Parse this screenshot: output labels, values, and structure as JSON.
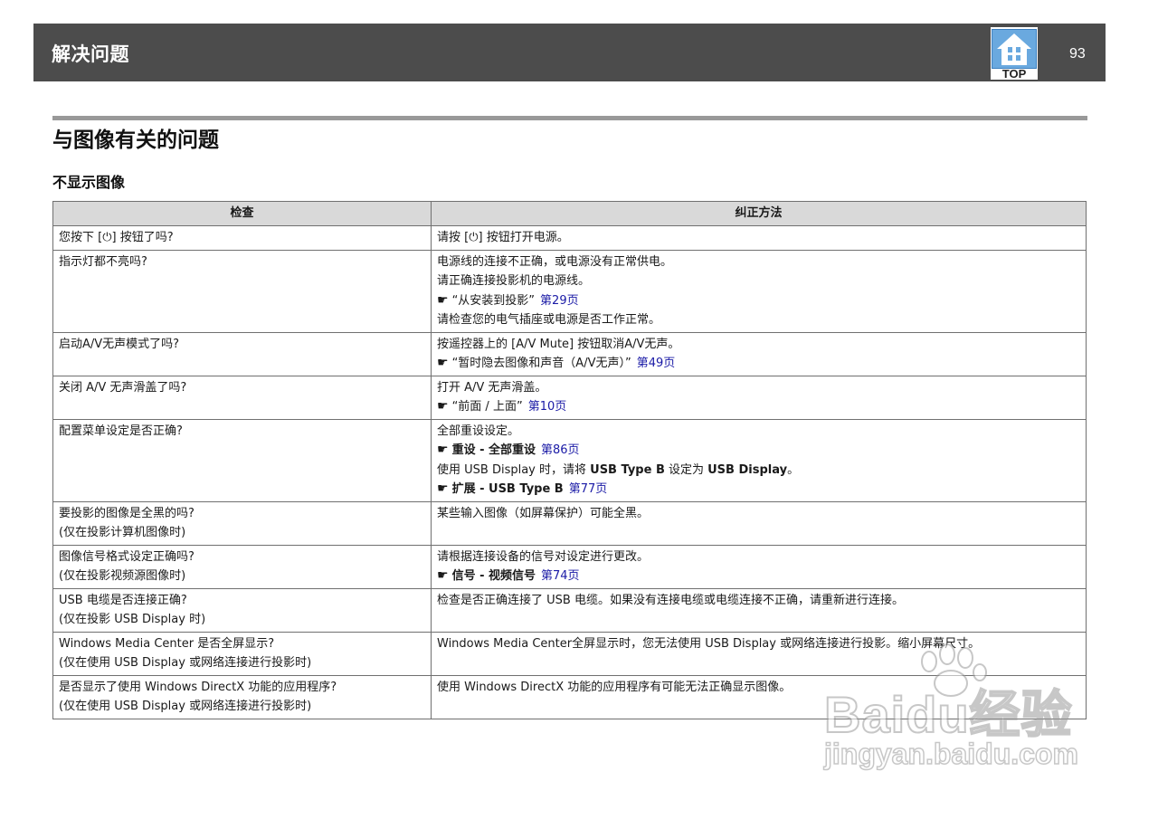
{
  "header": {
    "title": "解决问题",
    "top_label": "TOP",
    "page_number": "93"
  },
  "section_title": "与图像有关的问题",
  "subsection_title": "不显示图像",
  "table": {
    "columns": [
      "检查",
      "纠正方法"
    ],
    "rows": [
      {
        "check": [
          "您按下 [⏻] 按钮了吗?"
        ],
        "fix": [
          {
            "text": "请按 [⏻] 按钮打开电源。"
          }
        ]
      },
      {
        "check": [
          "指示灯都不亮吗?"
        ],
        "fix": [
          {
            "text": "电源线的连接不正确，或电源没有正常供电。"
          },
          {
            "text": "请正确连接投影机的电源线。"
          },
          {
            "ref": "“从安装到投影”",
            "page": "第29页"
          },
          {
            "text": "请检查您的电气插座或电源是否工作正常。"
          }
        ]
      },
      {
        "check": [
          "启动A/V无声模式了吗?"
        ],
        "fix": [
          {
            "text": "按遥控器上的 [A/V Mute] 按钮取消A/V无声。"
          },
          {
            "ref": "“暂时隐去图像和声音（A/V无声）”",
            "page": "第49页"
          }
        ]
      },
      {
        "check": [
          "关闭 A/V 无声滑盖了吗?"
        ],
        "fix": [
          {
            "text": "打开 A/V 无声滑盖。"
          },
          {
            "ref": "“前面 / 上面”",
            "page": "第10页"
          }
        ]
      },
      {
        "check": [
          "配置菜单设定是否正确?"
        ],
        "fix": [
          {
            "text": "全部重设设定。"
          },
          {
            "menu": "重设 - 全部重设",
            "page": "第86页"
          },
          {
            "text_a": "使用 USB Display 时，请将 ",
            "bold_a": "USB Type B",
            "text_b": " 设定为 ",
            "bold_b": "USB Display",
            "text_c": "。"
          },
          {
            "menu": "扩展 - USB Type B",
            "page": "第77页"
          }
        ]
      },
      {
        "check": [
          "要投影的图像是全黑的吗?",
          "(仅在投影计算机图像时)"
        ],
        "fix": [
          {
            "text": "某些输入图像（如屏幕保护）可能全黑。"
          }
        ]
      },
      {
        "check": [
          "图像信号格式设定正确吗?",
          "(仅在投影视频源图像时)"
        ],
        "fix": [
          {
            "text": "请根据连接设备的信号对设定进行更改。"
          },
          {
            "menu": "信号 - 视频信号",
            "page": "第74页"
          }
        ]
      },
      {
        "check": [
          "USB 电缆是否连接正确?",
          "(仅在投影 USB Display 时)"
        ],
        "fix": [
          {
            "text": "检查是否正确连接了 USB 电缆。如果没有连接电缆或电缆连接不正确，请重新进行连接。"
          }
        ]
      },
      {
        "check": [
          "Windows Media Center 是否全屏显示?",
          "(仅在使用 USB Display 或网络连接进行投影时)"
        ],
        "fix": [
          {
            "text": "Windows Media Center全屏显示时，您无法使用 USB Display 或网络连接进行投影。缩小屏幕尺寸。"
          }
        ]
      },
      {
        "check": [
          "是否显示了使用 Windows DirectX 功能的应用程序?",
          "(仅在使用 USB Display 或网络连接进行投影时)"
        ],
        "fix": [
          {
            "text": "使用 Windows DirectX 功能的应用程序有可能无法正确显示图像。"
          }
        ]
      }
    ]
  },
  "watermark": {
    "logo": "Baidu经验",
    "url": "jingyan.baidu.com"
  },
  "colors": {
    "header_bg": "#4c4c4c",
    "table_header_bg": "#d9d9d9",
    "link": "#1a1aa6",
    "rule": "#999999"
  },
  "icons": {
    "top": "house-top-icon",
    "xref": "pointing-hand-icon"
  }
}
